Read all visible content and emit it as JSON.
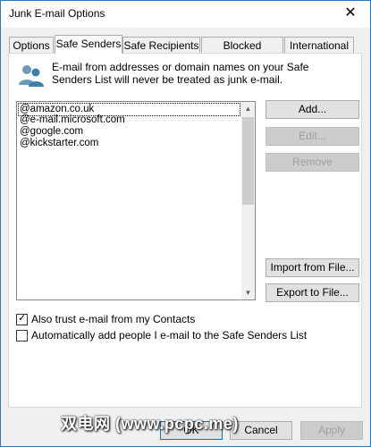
{
  "window": {
    "title": "Junk E-mail Options",
    "close_glyph": "✕"
  },
  "tabs": [
    {
      "label": "Options"
    },
    {
      "label": "Safe Senders"
    },
    {
      "label": "Safe Recipients"
    },
    {
      "label": "Blocked Senders"
    },
    {
      "label": "International"
    }
  ],
  "info_text": "E-mail from addresses or domain names on your Safe Senders List will never be treated as junk e-mail.",
  "safe_senders": [
    "@amazon.co.uk",
    "@e-mail.microsoft.com",
    "@google.com",
    "@kickstarter.com"
  ],
  "buttons": {
    "add": "Add...",
    "edit": "Edit...",
    "remove": "Remove",
    "import": "Import from File...",
    "export": "Export to File..."
  },
  "checkboxes": {
    "trust_contacts": {
      "label": "Also trust e-mail from my Contacts",
      "checked": true
    },
    "auto_add": {
      "label": "Automatically add people I e-mail to the Safe Senders List",
      "checked": false
    }
  },
  "footer": {
    "ok": "OK",
    "cancel": "Cancel",
    "apply": "Apply"
  },
  "watermark": "双电网 (www.pcpc.me)"
}
